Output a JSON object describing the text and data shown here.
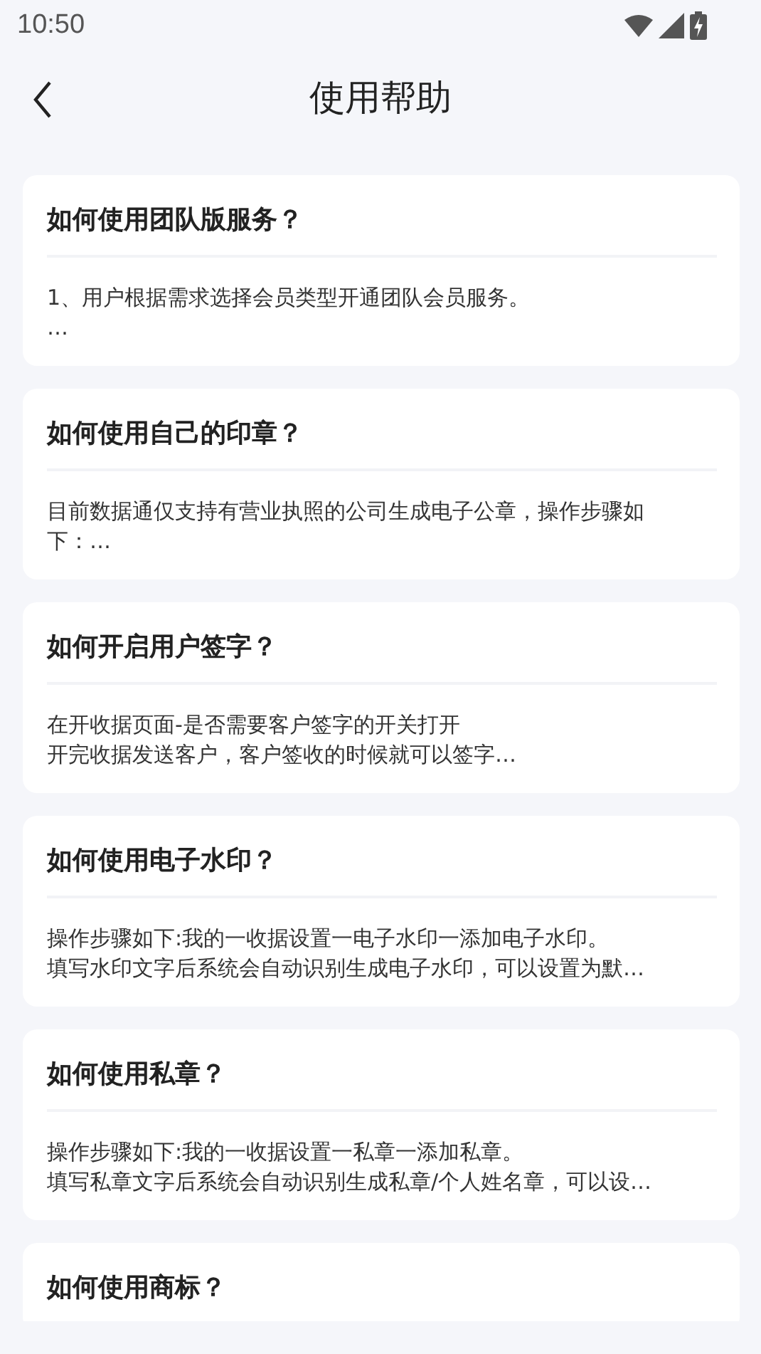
{
  "status_bar": {
    "time": "10:50"
  },
  "header": {
    "title": "使用帮助"
  },
  "faqs": [
    {
      "question": "如何使用团队版服务？",
      "lines": [
        "1、用户根据需求选择会员类型开通团队会员服务。",
        "…"
      ]
    },
    {
      "question": "如何使用自己的印章？",
      "lines": [
        "目前数据通仅支持有营业执照的公司生成电子公章，操作步骤如",
        "下：…"
      ]
    },
    {
      "question": "如何开启用户签字？",
      "lines": [
        "在开收据页面-是否需要客户签字的开关打开",
        "开完收据发送客户，客户签收的时候就可以签字…"
      ]
    },
    {
      "question": "如何使用电子水印？",
      "lines": [
        "操作步骤如下:我的一收据设置一电子水印一添加电子水印。",
        "填写水印文字后系统会自动识别生成电子水印，可以设置为默…"
      ]
    },
    {
      "question": "如何使用私章？",
      "lines": [
        "操作步骤如下:我的一收据设置一私章一添加私章。",
        "填写私章文字后系统会自动识别生成私章/个人姓名章，可以设…"
      ]
    },
    {
      "question": "如何使用商标？"
    }
  ]
}
